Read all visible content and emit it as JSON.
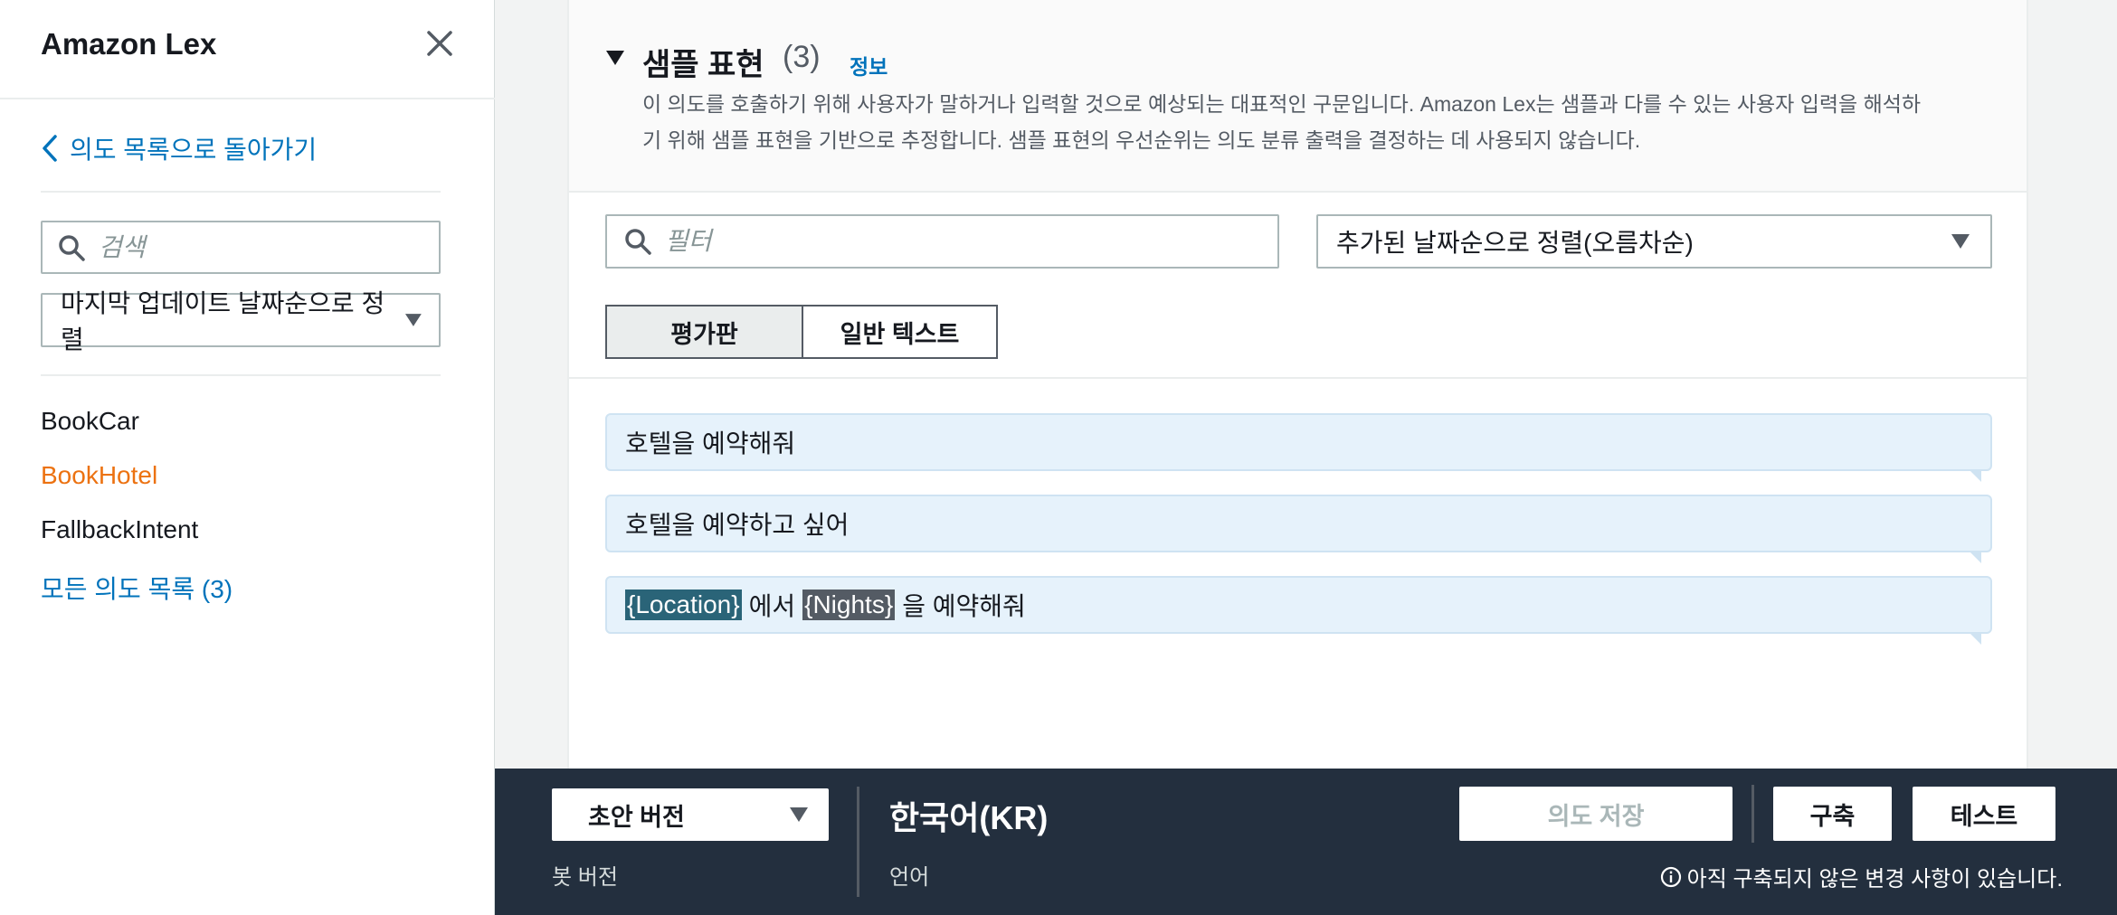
{
  "sidebar": {
    "title": "Amazon Lex",
    "back_link": "의도 목록으로 돌아가기",
    "search_placeholder": "검색",
    "sort_label": "마지막 업데이트 날짜순으로 정렬",
    "intents": [
      {
        "label": "BookCar",
        "active": false
      },
      {
        "label": "BookHotel",
        "active": true
      },
      {
        "label": "FallbackIntent",
        "active": false
      }
    ],
    "all_intents_link": "모든 의도 목록 (3)"
  },
  "section": {
    "title": "샘플 표현",
    "count": "(3)",
    "info_link": "정보",
    "description": "이 의도를 호출하기 위해 사용자가 말하거나 입력할 것으로 예상되는 대표적인 구문입니다. Amazon Lex는 샘플과 다를 수 있는 사용자 입력을 해석하기 위해 샘플 표현을 기반으로 추정합니다. 샘플 표현의 우선순위는 의도 분류 출력을 결정하는 데 사용되지 않습니다.",
    "filter_placeholder": "필터",
    "order_label": "추가된 날짜순으로 정렬(오름차순)",
    "view_modes": [
      "평가판",
      "일반 텍스트"
    ],
    "utterances": {
      "u1": "호텔을 예약해줘",
      "u2": "호텔을 예약하고 싶어",
      "u3": {
        "slot1": "{Location}",
        "text1": "에서",
        "slot2": "{Nights}",
        "text2": "을 예약해줘"
      }
    }
  },
  "bottombar": {
    "version_value": "초안 버전",
    "version_label": "봇 버전",
    "language_value": "한국어(KR)",
    "language_label": "언어",
    "save_button": "의도 저장",
    "build_button": "구축",
    "test_button": "테스트",
    "notice": "아직 구축되지 않은 변경 사항이 있습니다."
  },
  "colors": {
    "link": "#0073bb",
    "active_intent": "#ec7211",
    "bottombar_bg": "#232f3e",
    "utterance_bg": "#e6f2fb",
    "slot_location": "#2a6478",
    "slot_nights": "#545b64"
  }
}
